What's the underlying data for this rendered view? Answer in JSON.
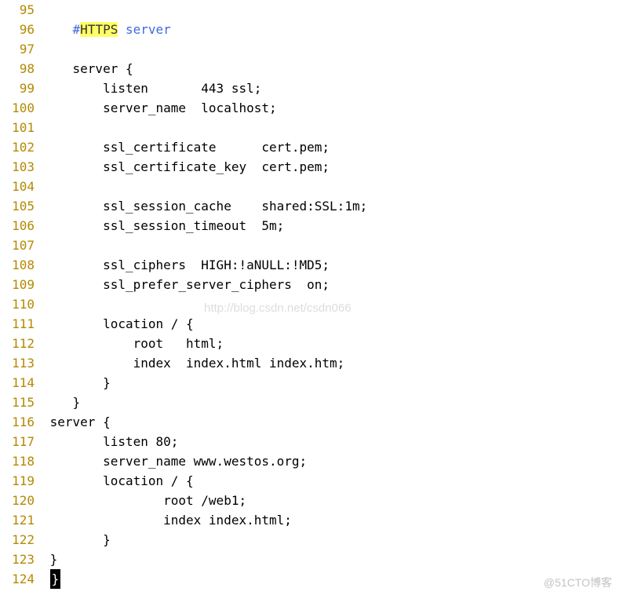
{
  "watermark1": "http://blog.csdn.net/csdn066",
  "watermark2": "@51CTO博客",
  "lines": [
    {
      "num": "95",
      "type": "plain",
      "text": ""
    },
    {
      "num": "96",
      "type": "comment",
      "indent": "    ",
      "hash": "#",
      "highlight": "HTTPS",
      "after": " server"
    },
    {
      "num": "97",
      "type": "plain",
      "text": ""
    },
    {
      "num": "98",
      "type": "plain",
      "text": "    server {"
    },
    {
      "num": "99",
      "type": "plain",
      "text": "        listen       443 ssl;"
    },
    {
      "num": "100",
      "type": "plain",
      "text": "        server_name  localhost;"
    },
    {
      "num": "101",
      "type": "plain",
      "text": ""
    },
    {
      "num": "102",
      "type": "plain",
      "text": "        ssl_certificate      cert.pem;"
    },
    {
      "num": "103",
      "type": "plain",
      "text": "        ssl_certificate_key  cert.pem;"
    },
    {
      "num": "104",
      "type": "plain",
      "text": ""
    },
    {
      "num": "105",
      "type": "plain",
      "text": "        ssl_session_cache    shared:SSL:1m;"
    },
    {
      "num": "106",
      "type": "plain",
      "text": "        ssl_session_timeout  5m;"
    },
    {
      "num": "107",
      "type": "plain",
      "text": ""
    },
    {
      "num": "108",
      "type": "plain",
      "text": "        ssl_ciphers  HIGH:!aNULL:!MD5;"
    },
    {
      "num": "109",
      "type": "plain",
      "text": "        ssl_prefer_server_ciphers  on;"
    },
    {
      "num": "110",
      "type": "plain",
      "text": ""
    },
    {
      "num": "111",
      "type": "plain",
      "text": "        location / {"
    },
    {
      "num": "112",
      "type": "plain",
      "text": "            root   html;"
    },
    {
      "num": "113",
      "type": "plain",
      "text": "            index  index.html index.htm;"
    },
    {
      "num": "114",
      "type": "plain",
      "text": "        }"
    },
    {
      "num": "115",
      "type": "plain",
      "text": "    }"
    },
    {
      "num": "116",
      "type": "plain",
      "text": " server {"
    },
    {
      "num": "117",
      "type": "plain",
      "text": "        listen 80;"
    },
    {
      "num": "118",
      "type": "plain",
      "text": "        server_name www.westos.org;"
    },
    {
      "num": "119",
      "type": "plain",
      "text": "        location / {"
    },
    {
      "num": "120",
      "type": "plain",
      "text": "                root /web1;"
    },
    {
      "num": "121",
      "type": "plain",
      "text": "                index index.html;"
    },
    {
      "num": "122",
      "type": "plain",
      "text": "        }"
    },
    {
      "num": "123",
      "type": "plain",
      "text": " }"
    },
    {
      "num": "124",
      "type": "cursor",
      "indent": " ",
      "char": "}"
    }
  ]
}
